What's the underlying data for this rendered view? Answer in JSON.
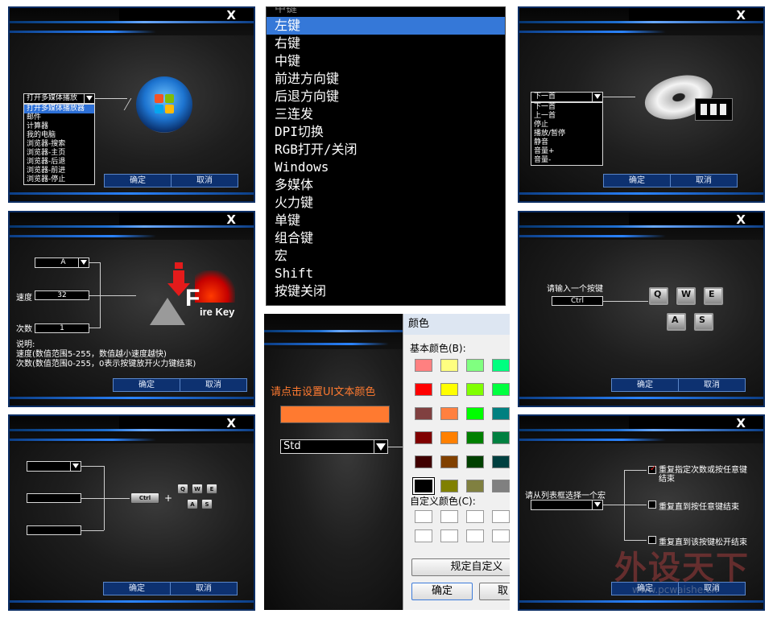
{
  "colors": {
    "accent": "#2c6fd6",
    "button_bg": "#0d3170",
    "ui_text_color": "#ff7a30"
  },
  "common": {
    "close": "X",
    "ok": "确定",
    "cancel": "取消"
  },
  "p1": {
    "select_value": "打开多媒体播放",
    "options": [
      "打开多媒体播放器",
      "邮件",
      "计算器",
      "我的电脑",
      "浏览器-搜索",
      "浏览器-主页",
      "浏览器-后退",
      "浏览器-前进",
      "浏览器-停止"
    ]
  },
  "p2": {
    "items": [
      "左键",
      "右键",
      "中键",
      "前进方向键",
      "后退方向键",
      "三连发",
      "DPI切换",
      "RGB打开/关闭",
      "Windows",
      "多媒体",
      "火力键",
      "单键",
      "组合键",
      "宏",
      "Shift",
      "按键关闭"
    ],
    "cut_item": "中键"
  },
  "p3": {
    "select_value": "下一首",
    "options": [
      "下一首",
      "上一首",
      "停止",
      "播放/暂停",
      "静音",
      "音量+",
      "音量-"
    ]
  },
  "p4": {
    "key_select": "A",
    "speed_label": "速度",
    "speed_value": "32",
    "count_label": "次数",
    "count_value": "1",
    "logo_text": "ire Key",
    "logo_letter": "F",
    "note_title": "说明:",
    "note_1": "速度(数值范围5-255，数值越小速度越快)",
    "note_2": "次数(数值范围0-255，0表示按键放开火力键结束)"
  },
  "p5": {
    "prompt": "请输入一个按键",
    "value": "Ctrl",
    "keys": [
      "Q",
      "W",
      "E",
      "A",
      "S"
    ]
  },
  "p6": {
    "ctrl": "Ctrl",
    "plus": "+",
    "keys": [
      "Q",
      "W",
      "E",
      "A",
      "S"
    ]
  },
  "p7": {
    "prompt": "请点击设置UI文本颜色",
    "select_value": "Std"
  },
  "p8": {
    "title": "颜色",
    "basic": "基本颜色(B):",
    "custom": "自定义颜色(C):",
    "define_btn": "规定自定义",
    "ok": "确定",
    "cancel_cut": "取",
    "swatches": [
      [
        "#ff8080",
        "#ffff80",
        "#80ff80",
        "#00ff80"
      ],
      [
        "#ff0000",
        "#ffff00",
        "#80ff00",
        "#00ff40"
      ],
      [
        "#804040",
        "#ff8040",
        "#00ff00",
        "#008080"
      ],
      [
        "#800000",
        "#ff8000",
        "#008000",
        "#008040"
      ],
      [
        "#400000",
        "#804000",
        "#004000",
        "#004040"
      ],
      [
        "#000000",
        "#808000",
        "#808040",
        "#808080"
      ]
    ]
  },
  "p9": {
    "prompt": "请从列表框选择一个宏",
    "opt1_a": "重复指定次数或按任意键",
    "opt1_b": "结束",
    "opt2": "重复直到按任意键结束",
    "opt3": "重复直到该按键松开结束"
  },
  "watermark": {
    "main": "外设天下",
    "url": "www.pcwaishe.cn"
  }
}
